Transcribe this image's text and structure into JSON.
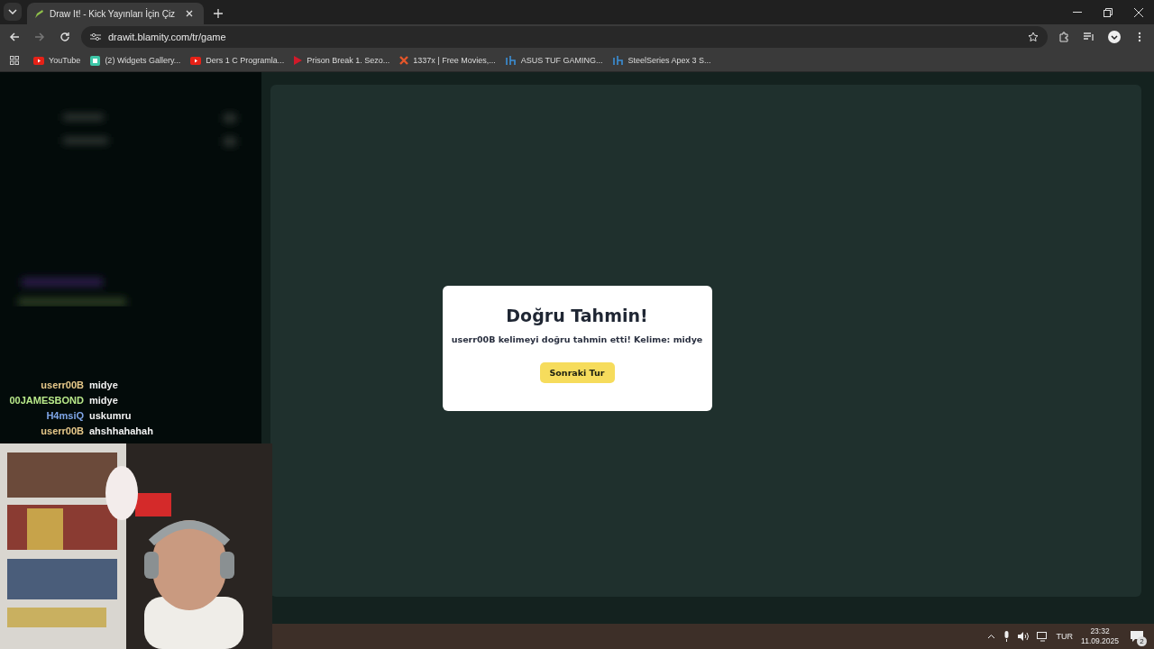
{
  "browser": {
    "tab": {
      "title": "Draw It! - Kick Yayınları İçin Çiz"
    },
    "address": "drawit.blamity.com/tr/game",
    "bookmarks": [
      {
        "label": "YouTube",
        "kind": "youtube"
      },
      {
        "label": "(2) Widgets Gallery...",
        "kind": "widgets"
      },
      {
        "label": "Ders 1 C Programla...",
        "kind": "youtube"
      },
      {
        "label": "Prison Break 1. Sezo...",
        "kind": "play"
      },
      {
        "label": "1337x | Free Movies,...",
        "kind": "cross"
      },
      {
        "label": "ASUS TUF GAMING...",
        "kind": "h"
      },
      {
        "label": "SteelSeries Apex 3 S...",
        "kind": "h"
      }
    ]
  },
  "chat": [
    {
      "user": "userr00B",
      "message": "midye",
      "color": "#e8c98a"
    },
    {
      "user": "00JAMESBOND",
      "message": "midye",
      "color": "#b9e98a"
    },
    {
      "user": "H4msiQ",
      "message": "uskumru",
      "color": "#7fa6e8"
    },
    {
      "user": "userr00B",
      "message": "ahshhahahah",
      "color": "#e8c98a"
    }
  ],
  "dialog": {
    "title": "Doğru Tahmin!",
    "message": "userr00B kelimeyi doğru tahmin etti! Kelime: midye",
    "button": "Sonraki Tur"
  },
  "taskbar": {
    "language": "TUR",
    "time": "23:32",
    "date": "11.09.2025",
    "notifications": "2"
  }
}
